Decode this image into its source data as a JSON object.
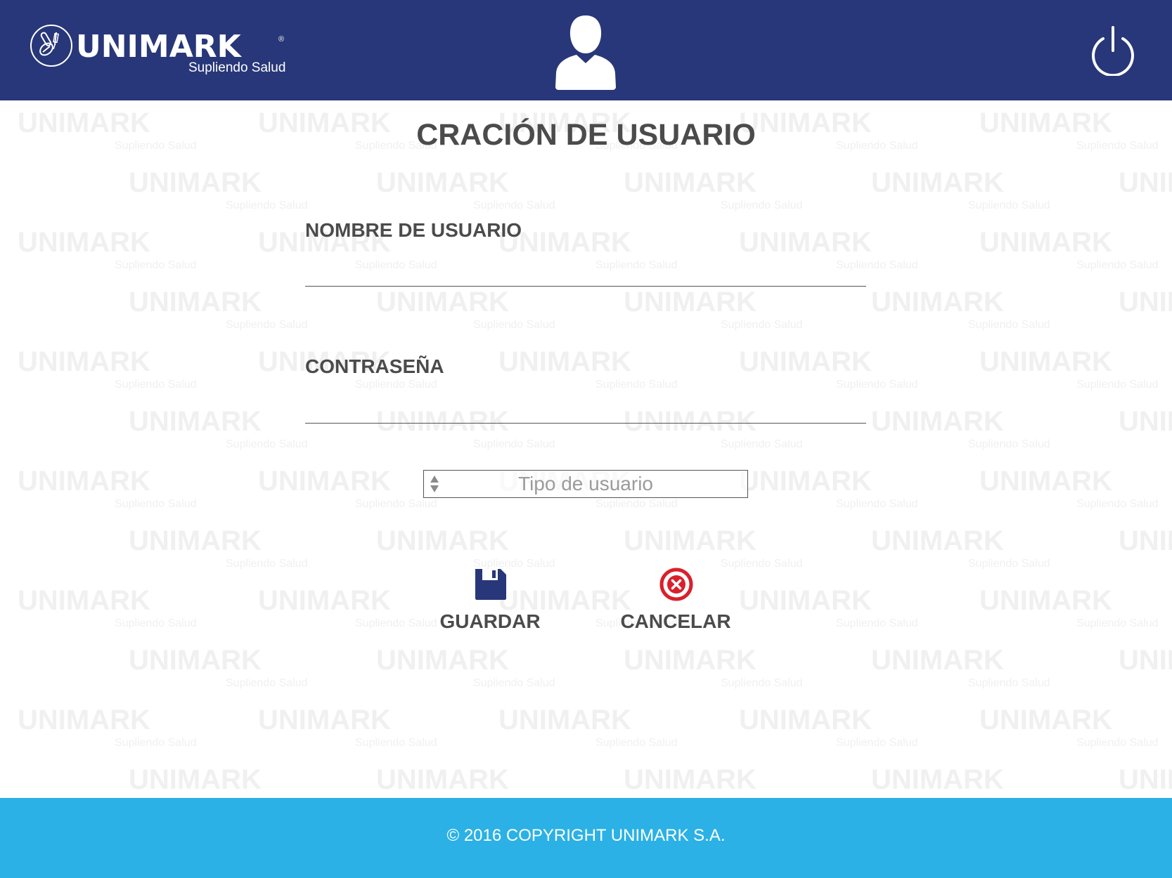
{
  "header": {
    "logo_name": "UNIMARK",
    "logo_registered": "®",
    "logo_tagline": "Supliendo Salud",
    "user_icon": "user-silhouette-icon",
    "power_icon": "power-icon"
  },
  "watermark": {
    "brand": "UNIMARK",
    "tagline": "Supliendo Salud"
  },
  "form": {
    "title": "CRACIÓN DE USUARIO",
    "username_label": "NOMBRE DE USUARIO",
    "username_value": "",
    "password_label": "CONTRASEÑA",
    "password_value": "",
    "user_type_placeholder": "Tipo de usuario"
  },
  "actions": {
    "save_label": "GUARDAR",
    "save_icon": "floppy-disk-icon",
    "cancel_label": "CANCELAR",
    "cancel_icon": "cancel-circle-icon"
  },
  "footer": {
    "copyright": "© 2016 COPYRIGHT UNIMARK S.A."
  },
  "colors": {
    "header_bg": "#283779",
    "footer_bg": "#2bb1e6",
    "text_dark": "#4b4b4b",
    "cancel_red": "#d9202b",
    "save_blue": "#283779"
  }
}
